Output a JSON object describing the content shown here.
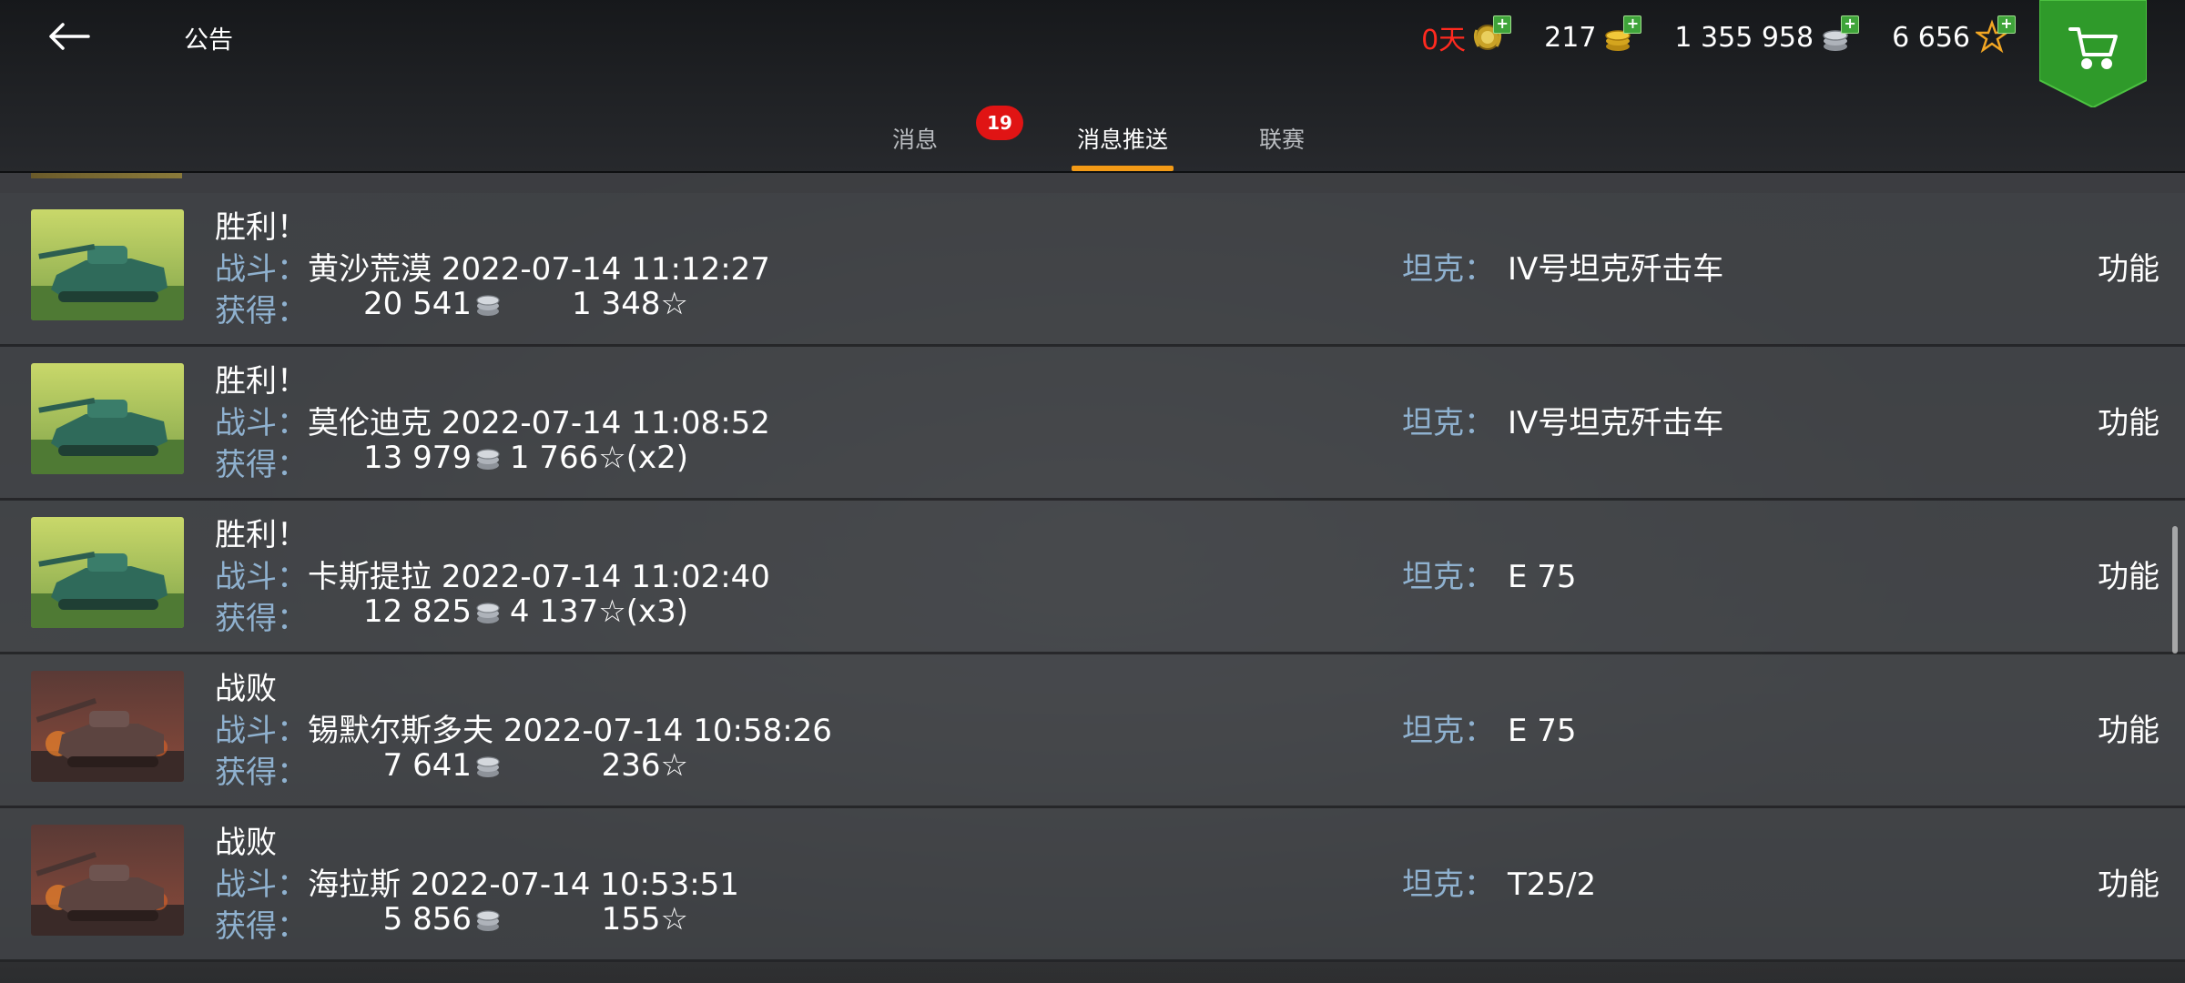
{
  "header": {
    "title": "公告",
    "currencies": [
      {
        "value": "0天",
        "icon": "premium-icon",
        "highlight": true
      },
      {
        "value": "217",
        "icon": "gold-icon",
        "highlight": false
      },
      {
        "value": "1 355 958",
        "icon": "credits-icon",
        "highlight": false
      },
      {
        "value": "6 656",
        "icon": "free-xp-icon",
        "highlight": false
      }
    ]
  },
  "tabs": [
    {
      "label": "消息",
      "badge": "19",
      "active": false
    },
    {
      "label": "消息推送",
      "active": true
    },
    {
      "label": "联赛",
      "active": false
    }
  ],
  "labels": {
    "battle": "战斗：",
    "earned": "获得：",
    "tank": "坦克：",
    "action": "功能"
  },
  "rows": [
    {
      "result": "胜利！",
      "outcome": "victory",
      "map": "黄沙荒漠",
      "time": "2022-07-14 11:12:27",
      "credits": "20 541",
      "xp": "1 348",
      "multiplier": "",
      "tank": "IV号坦克歼击车"
    },
    {
      "result": "胜利！",
      "outcome": "victory",
      "map": "莫伦迪克",
      "time": "2022-07-14 11:08:52",
      "credits": "13 979",
      "xp": "1 766",
      "multiplier": "(x2)",
      "tank": "IV号坦克歼击车"
    },
    {
      "result": "胜利！",
      "outcome": "victory",
      "map": "卡斯提拉",
      "time": "2022-07-14 11:02:40",
      "credits": "12 825",
      "xp": "4 137",
      "multiplier": "(x3)",
      "tank": "E 75"
    },
    {
      "result": "战败",
      "outcome": "defeat",
      "map": "锡默尔斯多夫",
      "time": "2022-07-14 10:58:26",
      "credits": "7 641",
      "xp": "236",
      "multiplier": "",
      "tank": "E 75"
    },
    {
      "result": "战败",
      "outcome": "defeat",
      "map": "海拉斯",
      "time": "2022-07-14 10:53:51",
      "credits": "5 856",
      "xp": "155",
      "multiplier": "",
      "tank": "T25/2"
    }
  ],
  "colors": {
    "accent": "#f39a16",
    "label": "#8fb1cf",
    "badge": "#e01414",
    "premium_text": "#ff2a1f",
    "shop": "#2f9a2a"
  }
}
